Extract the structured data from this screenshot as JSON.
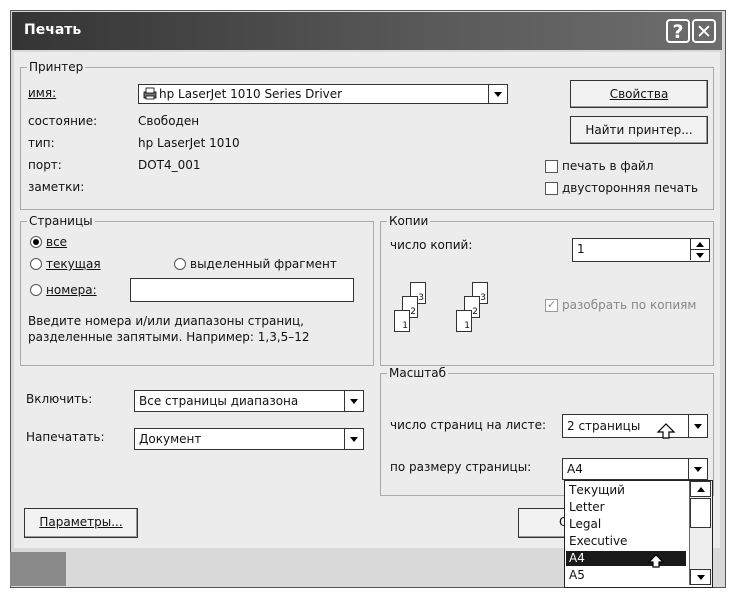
{
  "window": {
    "title": "Печать",
    "help_label": "?",
    "close_label": "✕"
  },
  "printer": {
    "legend": "Принтер",
    "name_label": "имя:",
    "name_value": "hp LaserJet 1010 Series Driver",
    "status_label": "состояние:",
    "status_value": "Свободен",
    "type_label": "тип:",
    "type_value": "hp LaserJet 1010",
    "port_label": "порт:",
    "port_value": "DOT4_001",
    "notes_label": "заметки:",
    "properties_button": "Свойства",
    "find_printer_button": "Найти принтер...",
    "print_to_file": "печать в файл",
    "duplex_print": "двусторонняя печать"
  },
  "pages": {
    "legend": "Страницы",
    "all": "все",
    "current": "текущая",
    "selection": "выделенный фрагмент",
    "numbers": "номера:",
    "hint_line1": "Введите номера и/или диапазоны страниц,",
    "hint_line2": "разделенные запятыми. Например: 1,3,5–12"
  },
  "copies": {
    "legend": "Копии",
    "count_label": "число копий:",
    "count_value": "1",
    "collate": "разобрать по копиям",
    "page_numbers": [
      "1",
      "2",
      "3"
    ]
  },
  "include": {
    "label": "Включить:",
    "value": "Все страницы диапазона"
  },
  "print_what": {
    "label": "Напечатать:",
    "value": "Документ"
  },
  "scale": {
    "legend": "Масштаб",
    "pages_per_sheet_label": "число страниц на листе:",
    "pages_per_sheet_value": "2 страницы",
    "fit_to_page_label": "по размеру страницы:",
    "fit_to_page_value": "A4",
    "options": [
      "Текущий",
      "Letter",
      "Legal",
      "Executive",
      "A4",
      "A5"
    ],
    "selected_option": "A4"
  },
  "footer": {
    "options_button": "Параметры...",
    "ok_button_partial": "О"
  },
  "colors": {
    "titlebar": "#3c3c3c",
    "dialog_bg": "#ececec",
    "selection": "#1a1a1a",
    "taskbar_block": "#8a8a8a"
  }
}
